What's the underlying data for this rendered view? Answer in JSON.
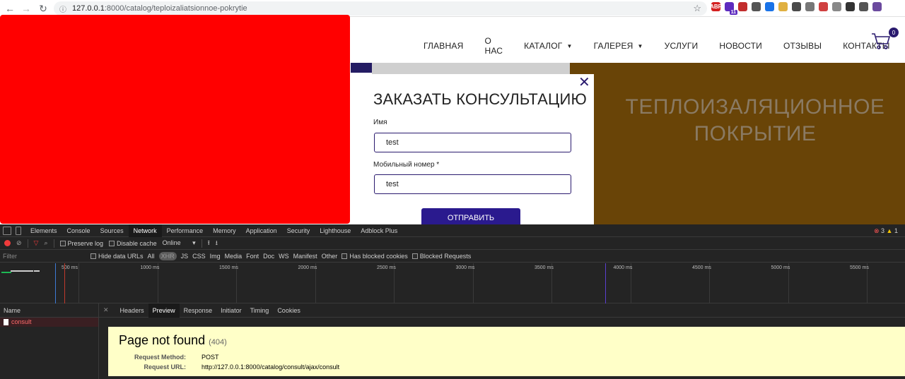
{
  "browser": {
    "url_host": "127.0.0.1",
    "url_rest": ":8000/catalog/teploizaliatsionnoe-pokrytie",
    "extensions": [
      {
        "name": "abp-icon",
        "color": "#d42020",
        "text": "ABP"
      },
      {
        "name": "puzzle-badge-icon",
        "color": "#5d2bbf",
        "text": "",
        "badge": "11"
      },
      {
        "name": "shield-icon",
        "color": "#c22d2d",
        "text": ""
      },
      {
        "name": "screenshot-icon",
        "color": "#555555",
        "text": ""
      },
      {
        "name": "tools-icon",
        "color": "#1a73e8",
        "text": ""
      },
      {
        "name": "note-icon",
        "color": "#e0b040",
        "text": ""
      },
      {
        "name": "vpn-icon",
        "color": "#4a4a4a",
        "text": ""
      },
      {
        "name": "download-icon",
        "color": "#777777",
        "text": ""
      },
      {
        "name": "eyedropper-icon",
        "color": "#d04040",
        "text": ""
      },
      {
        "name": "face-icon",
        "color": "#888888",
        "text": ""
      },
      {
        "name": "play-icon",
        "color": "#333333",
        "text": ""
      },
      {
        "name": "extensions-icon",
        "color": "#555555",
        "text": ""
      },
      {
        "name": "profile-icon",
        "color": "#6b4a9e",
        "text": ""
      }
    ]
  },
  "site": {
    "menu": [
      {
        "label": "ГЛАВНАЯ",
        "dropdown": false
      },
      {
        "label": "О НАС",
        "dropdown": false
      },
      {
        "label": "КАТАЛОГ",
        "dropdown": true
      },
      {
        "label": "ГАЛЕРЕЯ",
        "dropdown": true
      },
      {
        "label": "УСЛУГИ",
        "dropdown": false
      },
      {
        "label": "НОВОСТИ",
        "dropdown": false
      },
      {
        "label": "ОТЗЫВЫ",
        "dropdown": false
      },
      {
        "label": "КОНТАКТЫ",
        "dropdown": false
      }
    ],
    "cart_count": "0",
    "hero_title_line1": "ТЕПЛОИЗАЛЯЦИОННОЕ",
    "hero_title_line2": "ПОКРЫТИЕ"
  },
  "modal": {
    "title": "ЗАКАЗАТЬ КОНСУЛЬТАЦИЮ",
    "name_label": "Имя",
    "name_value": "test",
    "phone_label": "Мобильный номер *",
    "phone_value": "test",
    "submit_label": "ОТПРАВИТЬ"
  },
  "devtools": {
    "tabs": [
      "Elements",
      "Console",
      "Sources",
      "Network",
      "Performance",
      "Memory",
      "Application",
      "Security",
      "Lighthouse",
      "Adblock Plus"
    ],
    "active_tab": "Network",
    "error_count": "3",
    "warning_count": "1",
    "toolbar": {
      "preserve_log": "Preserve log",
      "disable_cache": "Disable cache",
      "throttling": "Online"
    },
    "filter": {
      "placeholder": "Filter",
      "hide_data_urls": "Hide data URLs",
      "types": [
        "All",
        "XHR",
        "JS",
        "CSS",
        "Img",
        "Media",
        "Font",
        "Doc",
        "WS",
        "Manifest",
        "Other"
      ],
      "active_type": "XHR",
      "has_blocked_cookies": "Has blocked cookies",
      "blocked_requests": "Blocked Requests"
    },
    "timeline_ticks": [
      "500 ms",
      "1000 ms",
      "1500 ms",
      "2000 ms",
      "2500 ms",
      "3000 ms",
      "3500 ms",
      "4000 ms",
      "4500 ms",
      "5000 ms",
      "5500 ms"
    ],
    "name_header": "Name",
    "request_name": "consult",
    "detail_tabs": [
      "Headers",
      "Preview",
      "Response",
      "Initiator",
      "Timing",
      "Cookies"
    ],
    "active_detail_tab": "Preview",
    "preview": {
      "title": "Page not found",
      "status": "(404)",
      "method_key": "Request Method:",
      "method_val": "POST",
      "url_key": "Request URL:",
      "url_val": "http://127.0.0.1:8000/catalog/consult/ajax/consult"
    }
  }
}
